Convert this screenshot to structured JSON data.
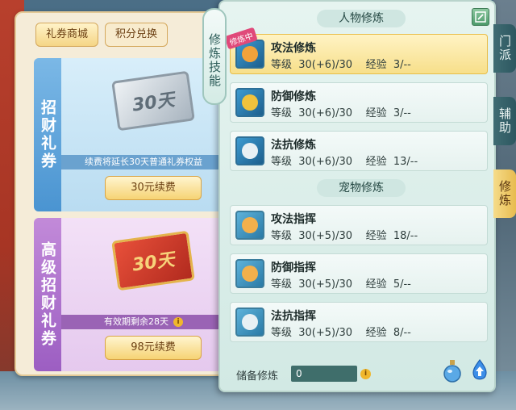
{
  "shop": {
    "tabs": [
      "礼券商城",
      "积分兑换"
    ],
    "cards": [
      {
        "title": "招财礼券",
        "ticket_text": "30天",
        "caption": "续费将延长30天普通礼券权益",
        "button": "30元续费"
      },
      {
        "title": "高级招财礼券",
        "ticket_text": "30天",
        "caption": "有效期剩余28天",
        "button": "98元续费"
      }
    ]
  },
  "panel": {
    "side_label": "修炼技能",
    "sections": {
      "character": "人物修炼",
      "pet": "宠物修炼"
    },
    "character_skills": [
      {
        "name": "攻法修炼",
        "level": "等级  30(+6)/30",
        "exp": "经验  3/--",
        "badge": "修炼中",
        "selected": true,
        "icon": "sword-icon"
      },
      {
        "name": "防御修炼",
        "level": "等级  30(+6)/30",
        "exp": "经验  3/--",
        "selected": false,
        "icon": "shield-icon"
      },
      {
        "name": "法抗修炼",
        "level": "等级  30(+6)/30",
        "exp": "经验  13/--",
        "selected": false,
        "icon": "taiji-shield-icon"
      }
    ],
    "pet_skills": [
      {
        "name": "攻法指挥",
        "level": "等级  30(+5)/30",
        "exp": "经验  18/--",
        "icon": "paw-attack-icon"
      },
      {
        "name": "防御指挥",
        "level": "等级  30(+5)/30",
        "exp": "经验  5/--",
        "icon": "paw-defense-icon"
      },
      {
        "name": "法抗指挥",
        "level": "等级  30(+5)/30",
        "exp": "经验  8/--",
        "icon": "paw-resist-icon"
      }
    ],
    "footer": {
      "reserve_label": "储备修炼",
      "reserve_value": "0"
    }
  },
  "right_tabs": [
    {
      "label": "门派",
      "active": false
    },
    {
      "label": "辅助",
      "active": false
    },
    {
      "label": "修炼",
      "active": true
    }
  ],
  "colors": {
    "selected_row": "#f7df8a",
    "panel_bg": "#e6f4f0",
    "active_tab": "#e7bb4f"
  }
}
